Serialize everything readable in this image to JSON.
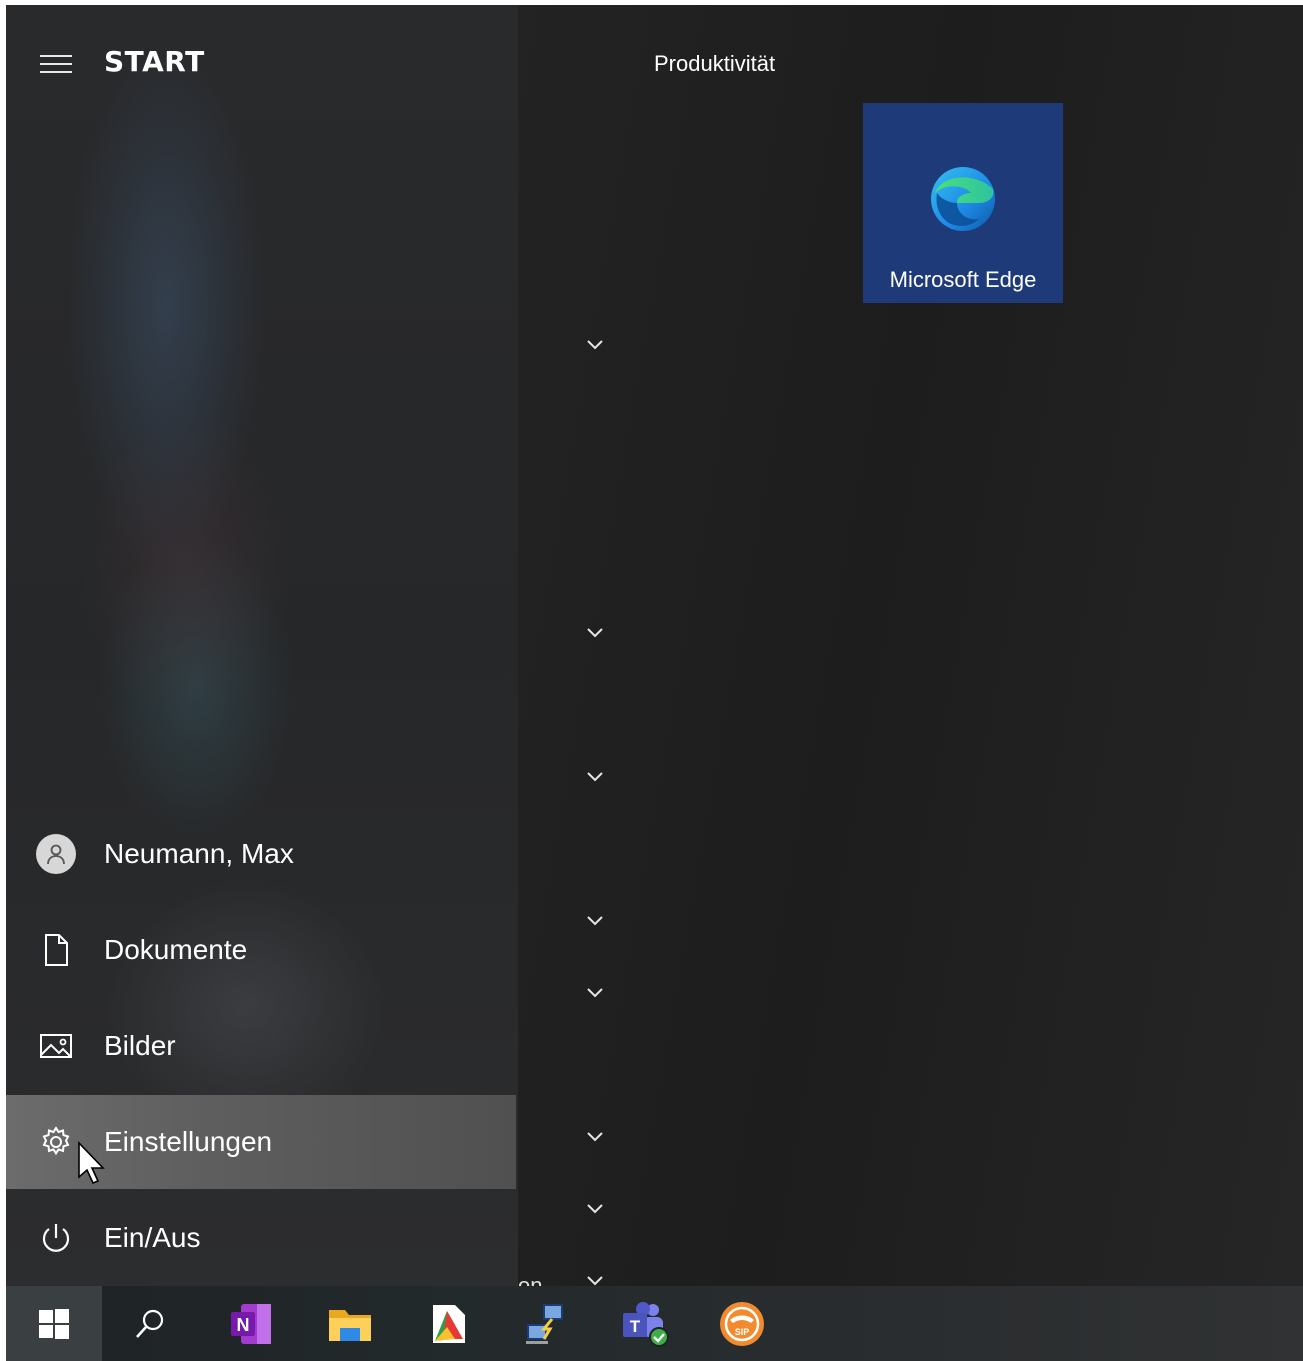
{
  "start": {
    "title": "START"
  },
  "user": {
    "name": "Neumann, Max"
  },
  "nav": [
    {
      "label": "Dokumente",
      "icon": "document-icon"
    },
    {
      "label": "Bilder",
      "icon": "picture-icon"
    },
    {
      "label": "Einstellungen",
      "icon": "gear-icon"
    },
    {
      "label": "Ein/Aus",
      "icon": "power-icon"
    }
  ],
  "tiles": {
    "group_title": "Produktivität",
    "edge": {
      "label": "Microsoft Edge",
      "icon": "edge-icon"
    }
  },
  "applist": {
    "truncated_text": "on"
  },
  "taskbar": {
    "items": [
      "windows-start-icon",
      "search-icon",
      "onenote-icon",
      "file-explorer-icon",
      "pdf-app-icon",
      "remote-desktop-icon",
      "teams-icon",
      "sip-phone-icon"
    ]
  },
  "colors": {
    "tile_blue": "#1e3a78",
    "hover_bg": "#5e5e5e"
  }
}
